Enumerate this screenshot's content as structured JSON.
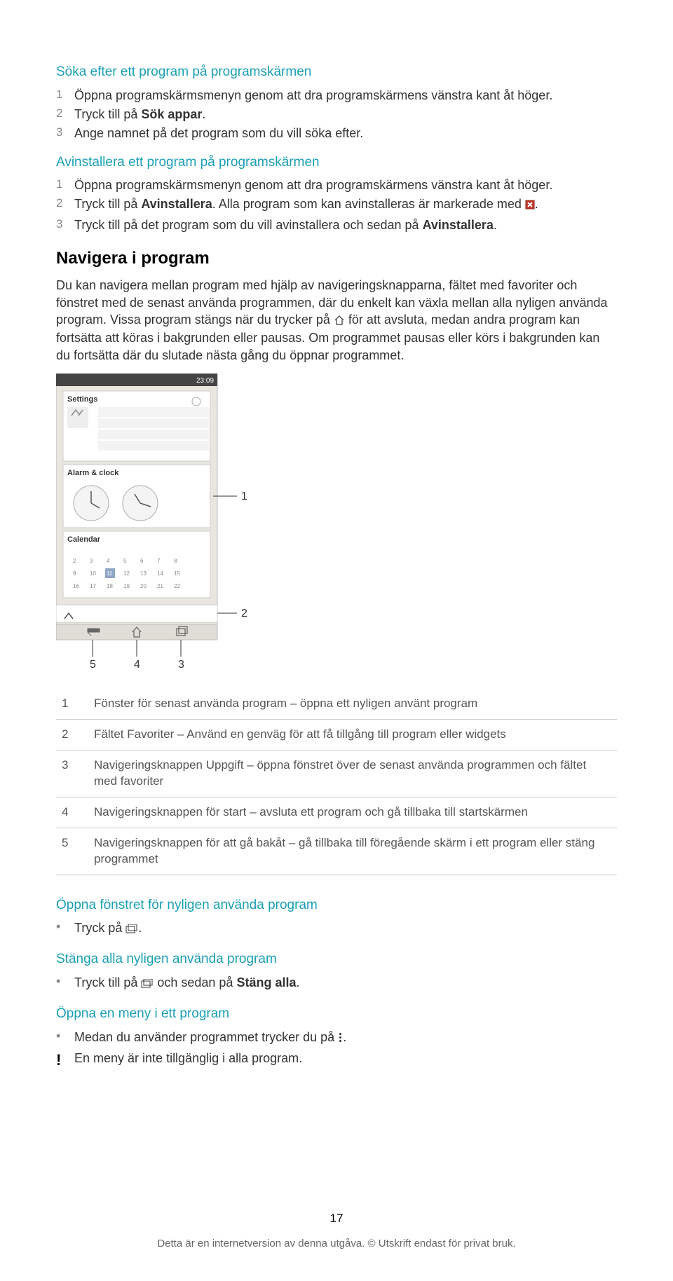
{
  "section1": {
    "heading": "Söka efter ett program på programskärmen",
    "steps": [
      {
        "n": "1",
        "text": "Öppna programskärmsmenyn genom att dra programskärmens vänstra kant åt höger."
      },
      {
        "n": "2",
        "pre": "Tryck till på ",
        "bold": "Sök appar",
        "post": "."
      },
      {
        "n": "3",
        "text": "Ange namnet på det program som du vill söka efter."
      }
    ]
  },
  "section2": {
    "heading": "Avinstallera ett program på programskärmen",
    "steps": [
      {
        "n": "1",
        "text": "Öppna programskärmsmenyn genom att dra programskärmens vänstra kant åt höger."
      },
      {
        "n": "2",
        "pre": "Tryck till på ",
        "bold": "Avinstallera",
        "post": ". Alla program som kan avinstalleras är markerade med ",
        "icon": "x"
      },
      {
        "n": "3",
        "pre": "Tryck till på det program som du vill avinstallera och sedan på ",
        "bold": "Avinstallera",
        "post": "."
      }
    ]
  },
  "nav_heading": "Navigera i program",
  "nav_para_pre": "Du kan navigera mellan program med hjälp av navigeringsknapparna, fältet med favoriter och fönstret med de senast använda programmen, där du enkelt kan växla mellan alla nyligen använda program. Vissa program stängs när du trycker på ",
  "nav_para_post": " för att avsluta, medan andra program kan fortsätta att köras i bakgrunden eller pausas. Om programmet pausas eller körs i bakgrunden kan du fortsätta där du slutade nästa gång du öppnar programmet.",
  "legend": [
    {
      "n": "1",
      "t": "Fönster för senast använda program – öppna ett nyligen använt program"
    },
    {
      "n": "2",
      "t": "Fältet Favoriter – Använd en genväg för att få tillgång till program eller widgets"
    },
    {
      "n": "3",
      "t": "Navigeringsknappen Uppgift – öppna fönstret över de senast använda programmen och fältet med favoriter"
    },
    {
      "n": "4",
      "t": "Navigeringsknappen för start – avsluta ett program och gå tillbaka till startskärmen"
    },
    {
      "n": "5",
      "t": "Navigeringsknappen för att gå bakåt – gå tillbaka till föregående skärm i ett program eller stäng programmet"
    }
  ],
  "section3": {
    "heading": "Öppna fönstret för nyligen använda program",
    "line_pre": "Tryck på ",
    "line_post": "."
  },
  "section4": {
    "heading": "Stänga alla nyligen använda program",
    "line_pre": "Tryck till på ",
    "line_mid": " och sedan på ",
    "bold": "Stäng alla",
    "line_post": "."
  },
  "section5": {
    "heading": "Öppna en meny i ett program",
    "line_pre": "Medan du använder programmet trycker du på ",
    "line_post": ".",
    "note": "En meny är inte tillgänglig i alla program."
  },
  "footer": {
    "page": "17",
    "text": "Detta är en internetversion av denna utgåva. © Utskrift endast för privat bruk."
  },
  "screenshot_labels": {
    "l1": "1",
    "l2": "2",
    "l3": "3",
    "l4": "4",
    "l5": "5",
    "settings": "Settings",
    "alarm": "Alarm & clock",
    "cal": "Calendar",
    "time": "23:09"
  }
}
